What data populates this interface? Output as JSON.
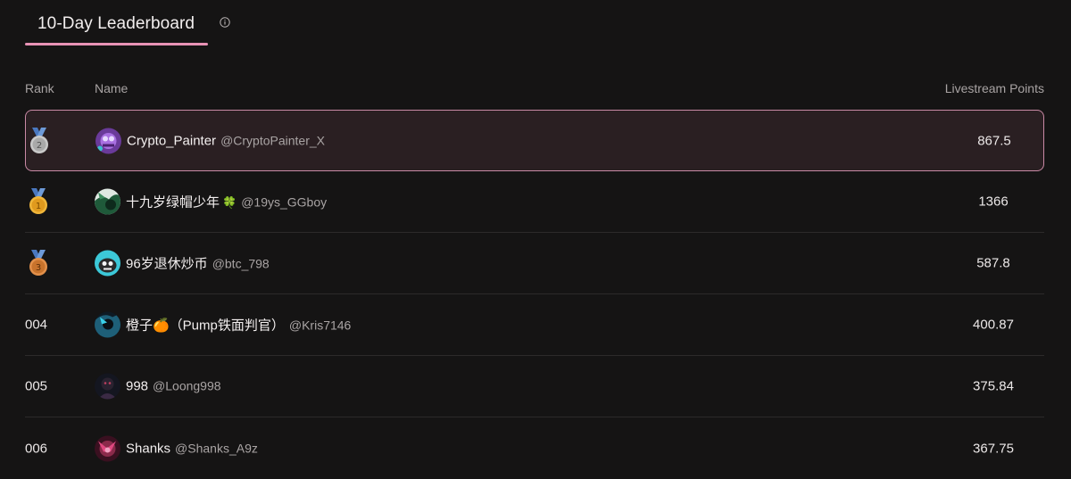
{
  "header": {
    "tab_label": "10-Day Leaderboard",
    "info_icon": "info-circle-icon",
    "accent_color": "#e892b5"
  },
  "columns": {
    "rank": "Rank",
    "name": "Name",
    "points": "Livestream Points"
  },
  "rows": [
    {
      "rank_label": "",
      "medal": "silver-medal-icon",
      "medal_number": "2",
      "display_name": "Crypto_Painter",
      "emoji": "",
      "handle": "@CryptoPainter_X",
      "points": "867.5",
      "highlighted": true
    },
    {
      "rank_label": "",
      "medal": "gold-medal-icon",
      "medal_number": "1",
      "display_name": "十九岁绿帽少年",
      "emoji": "🍀",
      "handle": "@19ys_GGboy",
      "points": "1366",
      "highlighted": false
    },
    {
      "rank_label": "",
      "medal": "bronze-medal-icon",
      "medal_number": "3",
      "display_name": "96岁退休炒币",
      "emoji": "",
      "handle": "@btc_798",
      "points": "587.8",
      "highlighted": false
    },
    {
      "rank_label": "004",
      "medal": "",
      "medal_number": "",
      "display_name": "橙子🍊（Pump铁面判官）",
      "emoji": "",
      "handle": "@Kris7146",
      "points": "400.87",
      "highlighted": false
    },
    {
      "rank_label": "005",
      "medal": "",
      "medal_number": "",
      "display_name": "998",
      "emoji": "",
      "handle": "@Loong998",
      "points": "375.84",
      "highlighted": false
    },
    {
      "rank_label": "006",
      "medal": "",
      "medal_number": "",
      "display_name": "Shanks",
      "emoji": "",
      "handle": "@Shanks_A9z",
      "points": "367.75",
      "highlighted": false
    }
  ]
}
